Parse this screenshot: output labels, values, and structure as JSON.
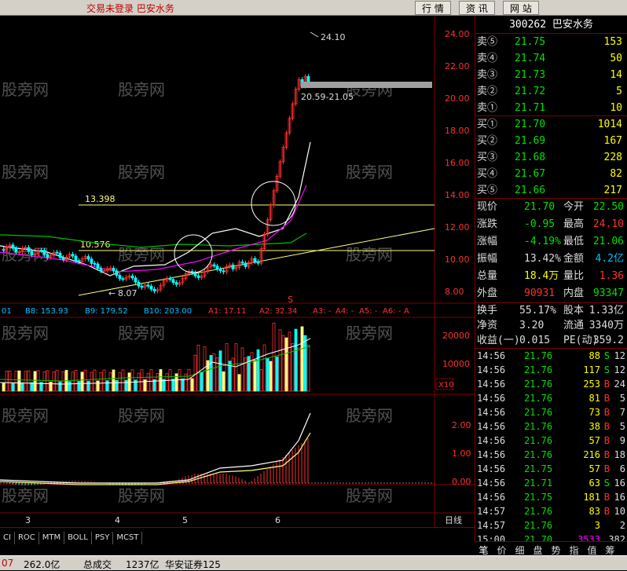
{
  "topbar": {
    "title": "交易未登录 巴安水务",
    "tabs": [
      "行 情",
      "资 讯",
      "网 站"
    ]
  },
  "chart": {
    "price_axis": [
      "24.00",
      "22.00",
      "20.00",
      "18.00",
      "16.00",
      "14.00",
      "12.00",
      "10.00",
      "8.00"
    ],
    "annotations": {
      "high": "24.10",
      "range": "20.59-21.05",
      "level1": "13.398",
      "level2": "10.576",
      "low": "8.07"
    },
    "indicator_line": [
      "01",
      "B8: 153.93",
      "B9: 179.52",
      "B10: 203.00",
      "A1: 17.11",
      "A2: 32.34",
      "A3: -",
      "A4: -",
      "A5: -",
      "A6: -",
      "A"
    ],
    "volume_axis": [
      "20000",
      "10000"
    ],
    "volume_unit": "X10",
    "macd_axis": [
      "2.00",
      "1.00",
      "0.00"
    ],
    "x_labels": [
      "3",
      "4",
      "5",
      "6"
    ],
    "period": "日线",
    "watermark": "股旁网"
  },
  "indicator_tabs": [
    "CI",
    "ROC",
    "MTM",
    "BOLL",
    "PSY",
    "MCST"
  ],
  "panel": {
    "header": "300262 巴安水务",
    "asks": [
      {
        "label": "卖⑤",
        "price": "21.75",
        "vol": "153"
      },
      {
        "label": "卖④",
        "price": "21.74",
        "vol": "50"
      },
      {
        "label": "卖③",
        "price": "21.73",
        "vol": "14"
      },
      {
        "label": "卖②",
        "price": "21.72",
        "vol": "5"
      },
      {
        "label": "卖①",
        "price": "21.71",
        "vol": "10"
      }
    ],
    "bids": [
      {
        "label": "买①",
        "price": "21.70",
        "vol": "1014"
      },
      {
        "label": "买②",
        "price": "21.69",
        "vol": "167"
      },
      {
        "label": "买③",
        "price": "21.68",
        "vol": "228"
      },
      {
        "label": "买④",
        "price": "21.67",
        "vol": "82"
      },
      {
        "label": "买⑤",
        "price": "21.66",
        "vol": "217"
      }
    ],
    "quote": [
      {
        "l1": "现价",
        "v1": "21.70",
        "l2": "今开",
        "v2": "22.50",
        "c1": "#00e000",
        "c2": "#00e000"
      },
      {
        "l1": "涨跌",
        "v1": "-0.95",
        "l2": "最高",
        "v2": "24.10",
        "c1": "#00e000",
        "c2": "#ff3030"
      },
      {
        "l1": "涨幅",
        "v1": "-4.19%",
        "l2": "最低",
        "v2": "21.06",
        "c1": "#00e000",
        "c2": "#00e000"
      },
      {
        "l1": "振幅",
        "v1": "13.42%",
        "l2": "金额",
        "v2": "4.2亿",
        "c1": "#ddd",
        "c2": "#00c0ff"
      },
      {
        "l1": "总量",
        "v1": "18.4万",
        "l2": "量比",
        "v2": "1.36",
        "c1": "#ffff00",
        "c2": "#ff3030"
      },
      {
        "l1": "外盘",
        "v1": "90931",
        "l2": "内盘",
        "v2": "93347",
        "c1": "#ff3030",
        "c2": "#00e000"
      }
    ],
    "stats": [
      {
        "l1": "换手",
        "v1": "55.17%",
        "l2": "股本",
        "v2": "1.33亿"
      },
      {
        "l1": "净资",
        "v1": "3.20",
        "l2": "流通",
        "v2": "3340万"
      },
      {
        "l1": "收益(一)",
        "v1": "0.015",
        "l2": "PE(动)",
        "v2": "359.2"
      }
    ],
    "ticks": [
      {
        "t": "14:56",
        "p": "21.76",
        "v": "88",
        "s": "S",
        "n": "12"
      },
      {
        "t": "14:56",
        "p": "21.76",
        "v": "117",
        "s": "S",
        "n": "12"
      },
      {
        "t": "14:56",
        "p": "21.76",
        "v": "253",
        "s": "B",
        "n": "24"
      },
      {
        "t": "14:56",
        "p": "21.76",
        "v": "81",
        "s": "B",
        "n": "5"
      },
      {
        "t": "14:56",
        "p": "21.76",
        "v": "73",
        "s": "B",
        "n": "7"
      },
      {
        "t": "14:56",
        "p": "21.76",
        "v": "38",
        "s": "B",
        "n": "5"
      },
      {
        "t": "14:56",
        "p": "21.76",
        "v": "57",
        "s": "B",
        "n": "9"
      },
      {
        "t": "14:56",
        "p": "21.76",
        "v": "216",
        "s": "B",
        "n": "18"
      },
      {
        "t": "14:56",
        "p": "21.75",
        "v": "57",
        "s": "B",
        "n": "6"
      },
      {
        "t": "14:56",
        "p": "21.71",
        "v": "63",
        "s": "S",
        "n": "16"
      },
      {
        "t": "14:56",
        "p": "21.75",
        "v": "181",
        "s": "B",
        "n": "16"
      },
      {
        "t": "14:57",
        "p": "21.76",
        "v": "83",
        "s": "B",
        "n": "10"
      },
      {
        "t": "14:57",
        "p": "21.76",
        "v": "3",
        "s": "",
        "n": "2"
      },
      {
        "t": "15:00",
        "p": "21.70",
        "v": "3533",
        "s": "",
        "n": "382"
      }
    ],
    "tabs": [
      "笔",
      "价",
      "细",
      "盘",
      "势",
      "指",
      "值",
      "筹"
    ]
  },
  "status": {
    "left": "07",
    "amount": "262.0亿",
    "total_label": "总成交",
    "total": "1237亿",
    "broker": "华安证券125"
  }
}
